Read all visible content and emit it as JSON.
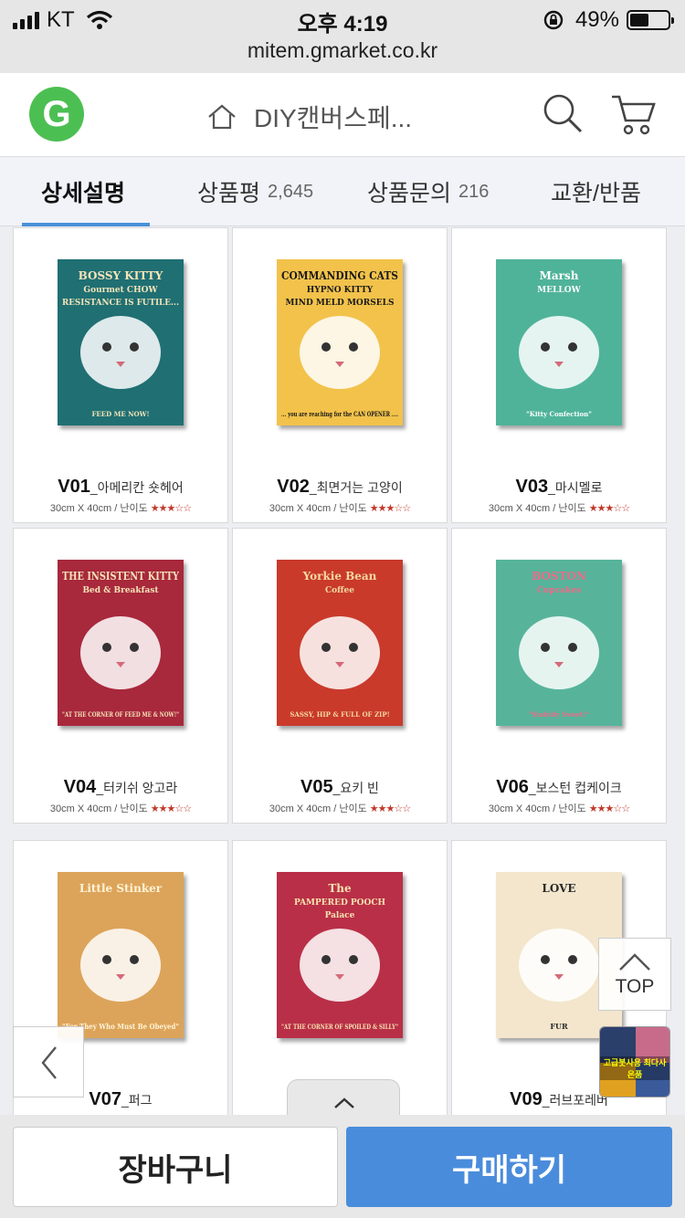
{
  "status": {
    "carrier": "KT",
    "time": "오후 4:19",
    "battery": "49%",
    "battery_level": 0.49,
    "url": "mitem.gmarket.co.kr"
  },
  "header": {
    "logo": "G",
    "title": "DIY캔버스페...",
    "icons": [
      "home-icon",
      "search-icon",
      "cart-icon"
    ]
  },
  "tabs": [
    {
      "label": "상세설명",
      "count": ""
    },
    {
      "label": "상품평",
      "count": "2,645"
    },
    {
      "label": "상품문의",
      "count": "216"
    },
    {
      "label": "교환/반품",
      "count": ""
    }
  ],
  "products": [
    {
      "code": "V01",
      "name": "_아메리칸 숏헤어",
      "spec": "30cm X 40cm / 난이도 ",
      "stars": "★★★☆☆",
      "poster_lines": [
        "BOSSY KITTY",
        "Gourmet CHOW",
        "RESISTANCE IS FUTILE...",
        "FEED ME NOW!"
      ],
      "bg": "#1f6f73",
      "fg": "#f4e4b8"
    },
    {
      "code": "V02",
      "name": "_최면거는 고양이",
      "spec": "30cm X 40cm / 난이도 ",
      "stars": "★★★☆☆",
      "poster_lines": [
        "COMMANDING CATS",
        "HYPNO KITTY",
        "MIND MELD MORSELS",
        "... you are reaching for the CAN OPENER ...."
      ],
      "bg": "#f2c24b",
      "fg": "#1a1a1a"
    },
    {
      "code": "V03",
      "name": "_마시멜로",
      "spec": "30cm X 40cm / 난이도 ",
      "stars": "★★★☆☆",
      "poster_lines": [
        "Marsh",
        "MELLOW",
        "\"Kitty Confection\""
      ],
      "bg": "#4fb39a",
      "fg": "#ffffff"
    },
    {
      "code": "V04",
      "name": "_터키쉬 앙고라",
      "spec": "30cm X 40cm / 난이도 ",
      "stars": "★★★☆☆",
      "poster_lines": [
        "THE INSISTENT KITTY",
        "Bed & Breakfast",
        "\"AT THE CORNER OF FEED ME & NOW!\""
      ],
      "bg": "#a8283c",
      "fg": "#f4e4b8"
    },
    {
      "code": "V05",
      "name": "_요키 빈",
      "spec": "30cm X 40cm / 난이도 ",
      "stars": "★★★☆☆",
      "poster_lines": [
        "Yorkie Bean",
        "Coffee",
        "SASSY, HIP & FULL OF ZIP!"
      ],
      "bg": "#c93a2b",
      "fg": "#f4d9a0"
    },
    {
      "code": "V06",
      "name": "_보스턴 컵케이크",
      "spec": "30cm X 40cm / 난이도 ",
      "stars": "★★★☆☆",
      "poster_lines": [
        "BOSTON",
        "Cupcakes",
        "\"Sinfully Sweet!\""
      ],
      "bg": "#57b49b",
      "fg": "#f06a8a"
    },
    {
      "code": "V07",
      "name": "_퍼그",
      "spec": "",
      "stars": "",
      "poster_lines": [
        "Little Stinker",
        "\"For They Who Must Be Obeyed\""
      ],
      "bg": "#dca45a",
      "fg": "#fff3d6"
    },
    {
      "code": "V08",
      "name": "",
      "spec": "",
      "stars": "",
      "poster_lines": [
        "The",
        "PAMPERED POOCH",
        "Palace",
        "\"AT THE CORNER OF SPOILED & SILLY\""
      ],
      "bg": "#b92f47",
      "fg": "#f7e2b0"
    },
    {
      "code": "V09",
      "name": "_러브포레버",
      "spec": "",
      "stars": "",
      "poster_lines": [
        "LOVE",
        "FUR"
      ],
      "bg": "#f3e6cc",
      "fg": "#2a2a2a"
    }
  ],
  "floating": {
    "top_label": "TOP",
    "thumb_label": "고급붓사용 최다사은품"
  },
  "bottom": {
    "cart": "장바구니",
    "buy": "구매하기"
  }
}
